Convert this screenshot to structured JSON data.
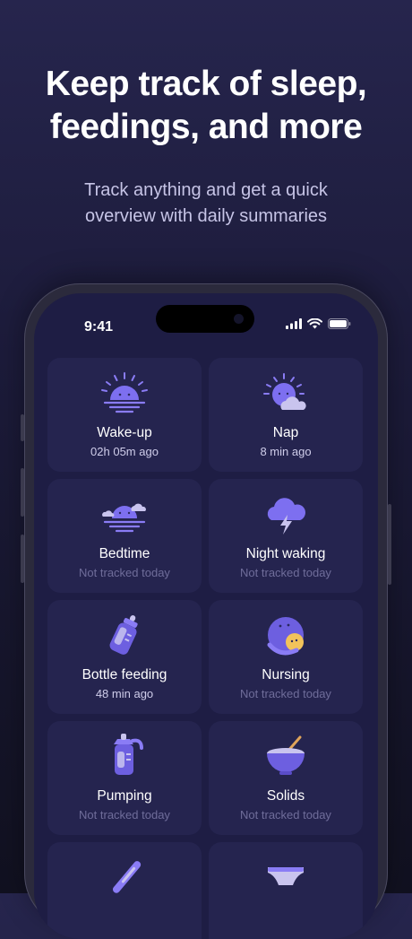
{
  "headline": {
    "line1": "Keep track of sleep,",
    "line2": "feedings, and more"
  },
  "subhead": {
    "line1": "Track anything and get a quick",
    "line2": "overview with daily summaries"
  },
  "status_bar": {
    "time": "9:41"
  },
  "colors": {
    "accent": "#8a7cf5",
    "card": "#25244f",
    "screen": "#1e1d44"
  },
  "cards": [
    {
      "title": "Wake-up",
      "sub": "02h 05m ago",
      "icon": "sunrise-icon"
    },
    {
      "title": "Nap",
      "sub": "8 min ago",
      "icon": "sun-cloud-icon"
    },
    {
      "title": "Bedtime",
      "sub": "Not tracked today",
      "icon": "sunset-icon"
    },
    {
      "title": "Night waking",
      "sub": "Not tracked today",
      "icon": "storm-cloud-icon"
    },
    {
      "title": "Bottle feeding",
      "sub": "48 min ago",
      "icon": "baby-bottle-icon"
    },
    {
      "title": "Nursing",
      "sub": "Not tracked today",
      "icon": "nursing-icon"
    },
    {
      "title": "Pumping",
      "sub": "Not tracked today",
      "icon": "pump-bottle-icon"
    },
    {
      "title": "Solids",
      "sub": "Not tracked today",
      "icon": "food-bowl-icon"
    },
    {
      "title": "",
      "sub": "",
      "icon": "thermometer-icon"
    },
    {
      "title": "",
      "sub": "",
      "icon": "diaper-icon"
    }
  ]
}
